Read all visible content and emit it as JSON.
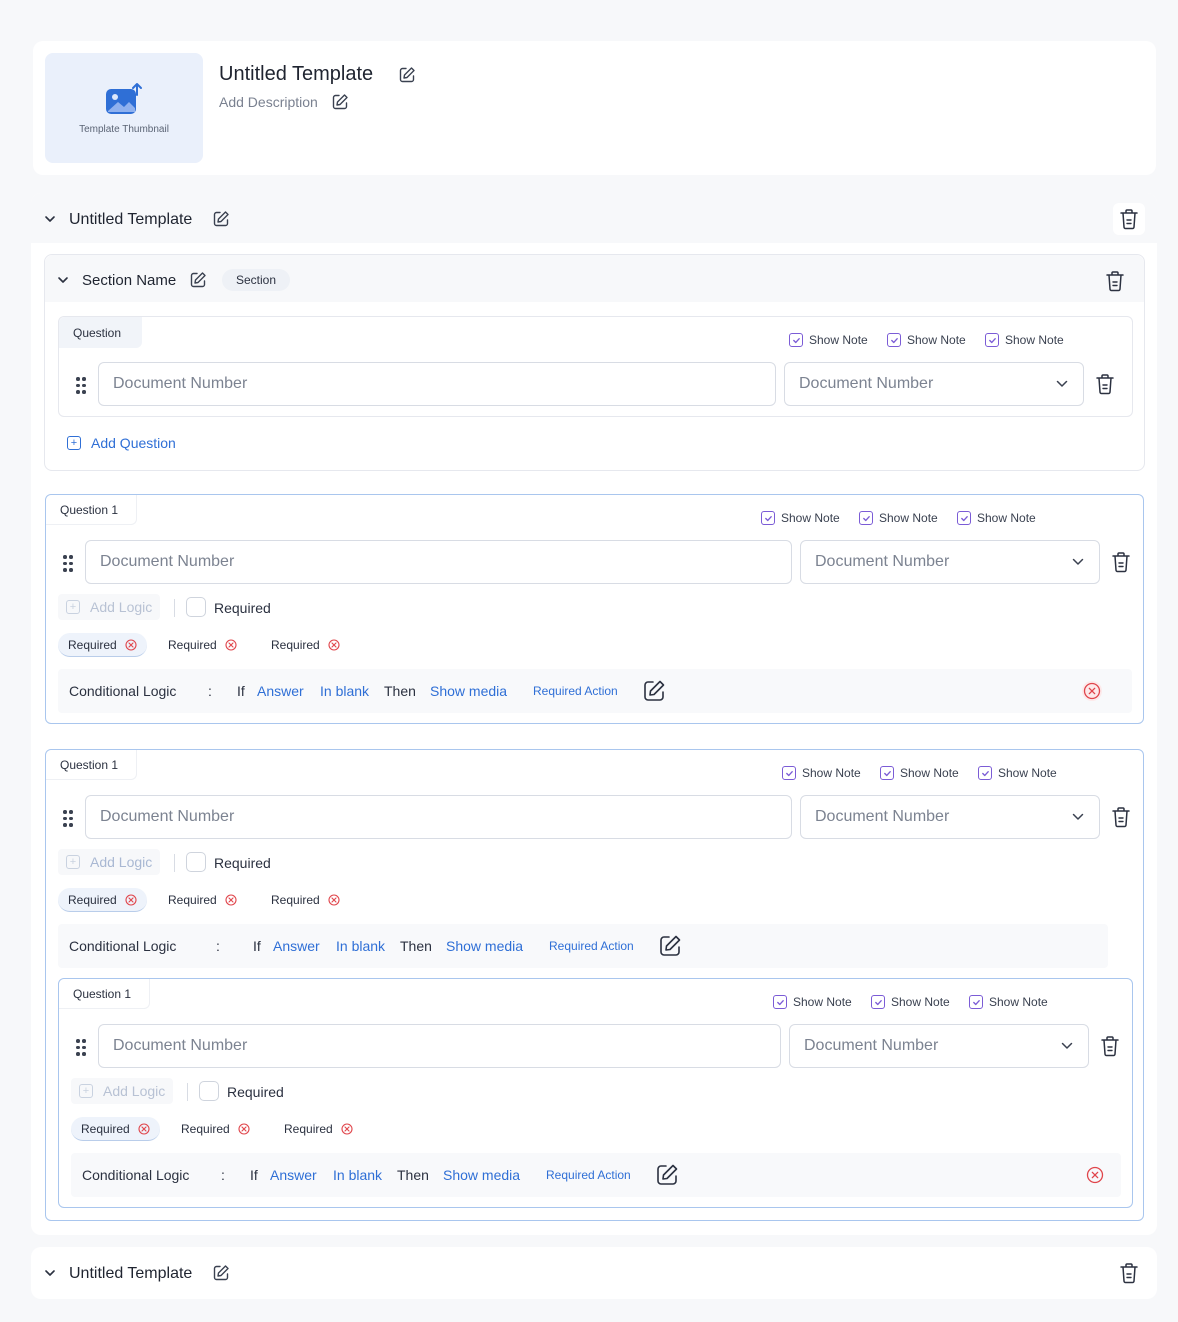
{
  "header": {
    "thumbnail_label": "Template Thumbnail",
    "title": "Untitled Template",
    "description": "Add Description"
  },
  "templates": [
    {
      "title": "Untitled Template"
    },
    {
      "title": "Untitled Template"
    }
  ],
  "section": {
    "name": "Section Name",
    "badge": "Section",
    "question": {
      "tab": "Question",
      "notes": [
        "Show Note",
        "Show Note",
        "Show Note"
      ],
      "input_placeholder": "Document Number",
      "select_value": "Document Number"
    },
    "add_question": "Add Question"
  },
  "question_card": {
    "tab": "Question 1",
    "notes": [
      "Show Note",
      "Show Note",
      "Show Note"
    ],
    "input_placeholder": "Document Number",
    "select_value": "Document Number",
    "add_logic": "Add Logic",
    "required_label": "Required",
    "chips": [
      "Required",
      "Required",
      "Required"
    ],
    "logic": {
      "label": "Conditional Logic",
      "colon": ":",
      "if": "If",
      "answer": "Answer",
      "condition": "In blank",
      "then": "Then",
      "action": "Show media",
      "required_action": "Required Action"
    }
  },
  "colors": {
    "accent": "#2f6fd6",
    "checkbox": "#7b5cd6",
    "danger": "#e0454b",
    "thumbnail_bg": "#eaf0fb"
  }
}
